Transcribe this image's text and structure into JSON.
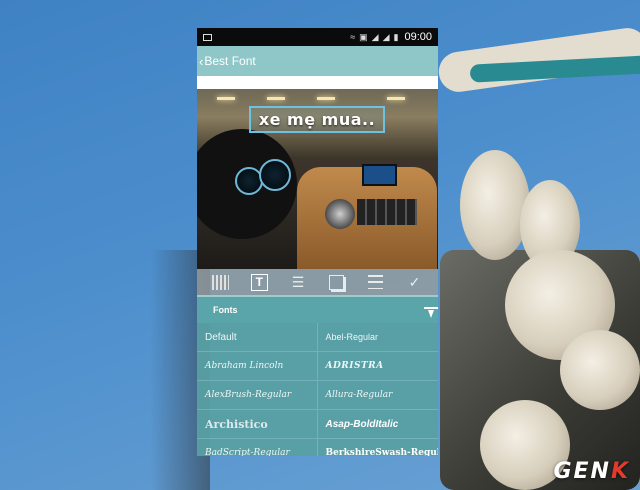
{
  "statusbar": {
    "time": "09:00",
    "icons": [
      "wifi-icon",
      "nfc-icon",
      "signal-icon",
      "signal-icon-2",
      "battery-icon"
    ]
  },
  "appbar": {
    "back_icon": "chevron-left-icon",
    "title": "Best Font"
  },
  "canvas": {
    "overlay_text": "xe mẹ mua.."
  },
  "toolbar": {
    "items": [
      {
        "name": "grid-icon"
      },
      {
        "name": "text-icon",
        "label": "T",
        "active": true
      },
      {
        "name": "paint-roller-icon"
      },
      {
        "name": "layers-icon"
      },
      {
        "name": "align-icon"
      },
      {
        "name": "check-icon"
      }
    ]
  },
  "fonts_panel": {
    "header": "Fonts",
    "download_icon": "download-icon",
    "fonts": [
      "Default",
      "Abel-Regular",
      "Abraham Lincoln",
      "ADRISTRA",
      "AlexBrush-Regular",
      "Allura-Regular",
      "Archistico",
      "Asap-BoldItalic",
      "BadScript-Regular",
      "BerkshireSwash-Regular"
    ]
  },
  "watermark": {
    "prefix": "GEN",
    "suffix": "K"
  },
  "colors": {
    "appbar": "#8fc6c8",
    "panel": "#5aa5a9",
    "textbox_border": "#6ec1e0",
    "watermark_k": "#e23b2c"
  }
}
